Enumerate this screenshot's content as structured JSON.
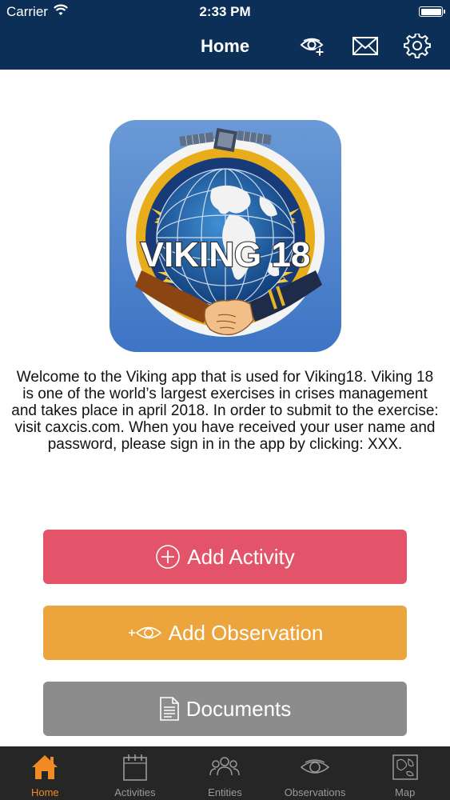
{
  "status_bar": {
    "carrier": "Carrier",
    "time": "2:33 PM"
  },
  "nav": {
    "title": "Home",
    "icons": [
      "add-observation-icon",
      "mail-icon",
      "settings-icon"
    ]
  },
  "logo": {
    "text": "VIKING 18"
  },
  "welcome_text": "Welcome to the Viking app that is used for Viking18. Viking 18 is one of the world’s largest exercises in crises management and takes place in april 2018. In order to submit to the exercise: visit caxcis.com. When you have received your user name and password, please sign in in the app by clicking: XXX.",
  "buttons": {
    "add_activity": "Add Activity",
    "add_observation": "Add Observation",
    "documents": "Documents"
  },
  "tabs": [
    {
      "label": "Home",
      "icon": "home-icon",
      "active": true
    },
    {
      "label": "Activities",
      "icon": "calendar-icon",
      "active": false
    },
    {
      "label": "Entities",
      "icon": "people-icon",
      "active": false
    },
    {
      "label": "Observations",
      "icon": "eye-icon",
      "active": false
    },
    {
      "label": "Map",
      "icon": "map-icon",
      "active": false
    }
  ],
  "colors": {
    "nav_bg": "#0b2f57",
    "add_activity": "#e3546a",
    "add_observation": "#eba53c",
    "documents": "#8c8c8c",
    "tab_active": "#f08a24",
    "tabbar_bg": "#262626"
  }
}
